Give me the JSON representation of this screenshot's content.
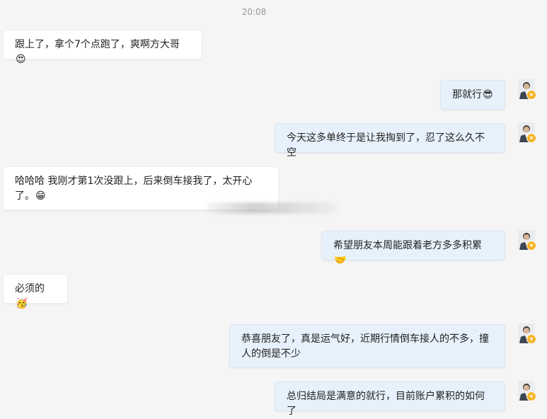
{
  "chat": {
    "timestamp": "20:08",
    "messages": [
      {
        "side": "left",
        "text": "跟上了，拿个7个点跑了，爽啊方大哥",
        "emoji": "😍"
      },
      {
        "side": "right",
        "text": "那就行",
        "emoji": "😎"
      },
      {
        "side": "right",
        "text": "今天这多单终于是让我掏到了，忍了这么久不空",
        "emoji": ""
      },
      {
        "side": "left",
        "text": "哈哈哈 我刚才第1次没跟上，后来倒车接我了，太开心了。",
        "emoji": "😁"
      },
      {
        "side": "right",
        "text": "希望朋友本周能跟着老方多多积累",
        "emoji": "🤝"
      },
      {
        "side": "left",
        "text": "必须的",
        "emoji": "🥳"
      },
      {
        "side": "right",
        "text": "恭喜朋友了，真是运气好，近期行情倒车接人的不多，撞人的倒是不少",
        "emoji": ""
      },
      {
        "side": "right",
        "text": "总归结局是满意的就行，目前账户累积的如何了",
        "emoji": ""
      }
    ],
    "avatar_badge": "v",
    "colors": {
      "background": "#f5f5f5",
      "left_bubble": "#ffffff",
      "right_bubble": "#e7f1fb",
      "badge": "#f6b324"
    }
  }
}
